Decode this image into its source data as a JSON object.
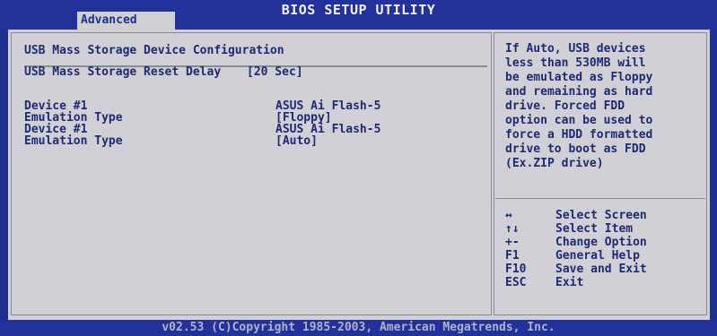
{
  "title_bar": {
    "title": "BIOS SETUP UTILITY",
    "active_tab": "Advanced"
  },
  "main": {
    "section_title": "USB Mass Storage Device Configuration",
    "reset_delay": {
      "label": "USB Mass Storage Reset Delay",
      "value": "[20 Sec]"
    },
    "devices": [
      {
        "device_label": "Device #1",
        "device_name": "ASUS Ai Flash-5",
        "emulation_label": "Emulation Type",
        "emulation_value": "[Floppy]"
      },
      {
        "device_label": "Device #1",
        "device_name": "ASUS Ai Flash-5",
        "emulation_label": "Emulation Type",
        "emulation_value": "[Auto]"
      }
    ]
  },
  "help": {
    "lines": [
      "If Auto, USB devices",
      "less than 530MB will",
      "be emulated as Floppy",
      "and remaining as hard",
      "drive. Forced FDD",
      "option can be used to",
      "force a HDD formatted",
      "drive to boot as FDD",
      "(Ex.ZIP drive)"
    ],
    "keys": [
      {
        "key": "↔",
        "action": "Select Screen"
      },
      {
        "key": "↑↓",
        "action": "Select Item"
      },
      {
        "key": "+-",
        "action": "Change Option"
      },
      {
        "key": "F1",
        "action": "General Help"
      },
      {
        "key": "F10",
        "action": "Save and Exit"
      },
      {
        "key": "ESC",
        "action": "Exit"
      }
    ]
  },
  "status_bar": {
    "copyright": "v02.53 (C)Copyright 1985-2003, American Megatrends, Inc."
  },
  "colors": {
    "background": "#1f2f8c",
    "panel": "#d0d0d6",
    "text": "#1f2a70",
    "tab": "#cfcfd4"
  }
}
